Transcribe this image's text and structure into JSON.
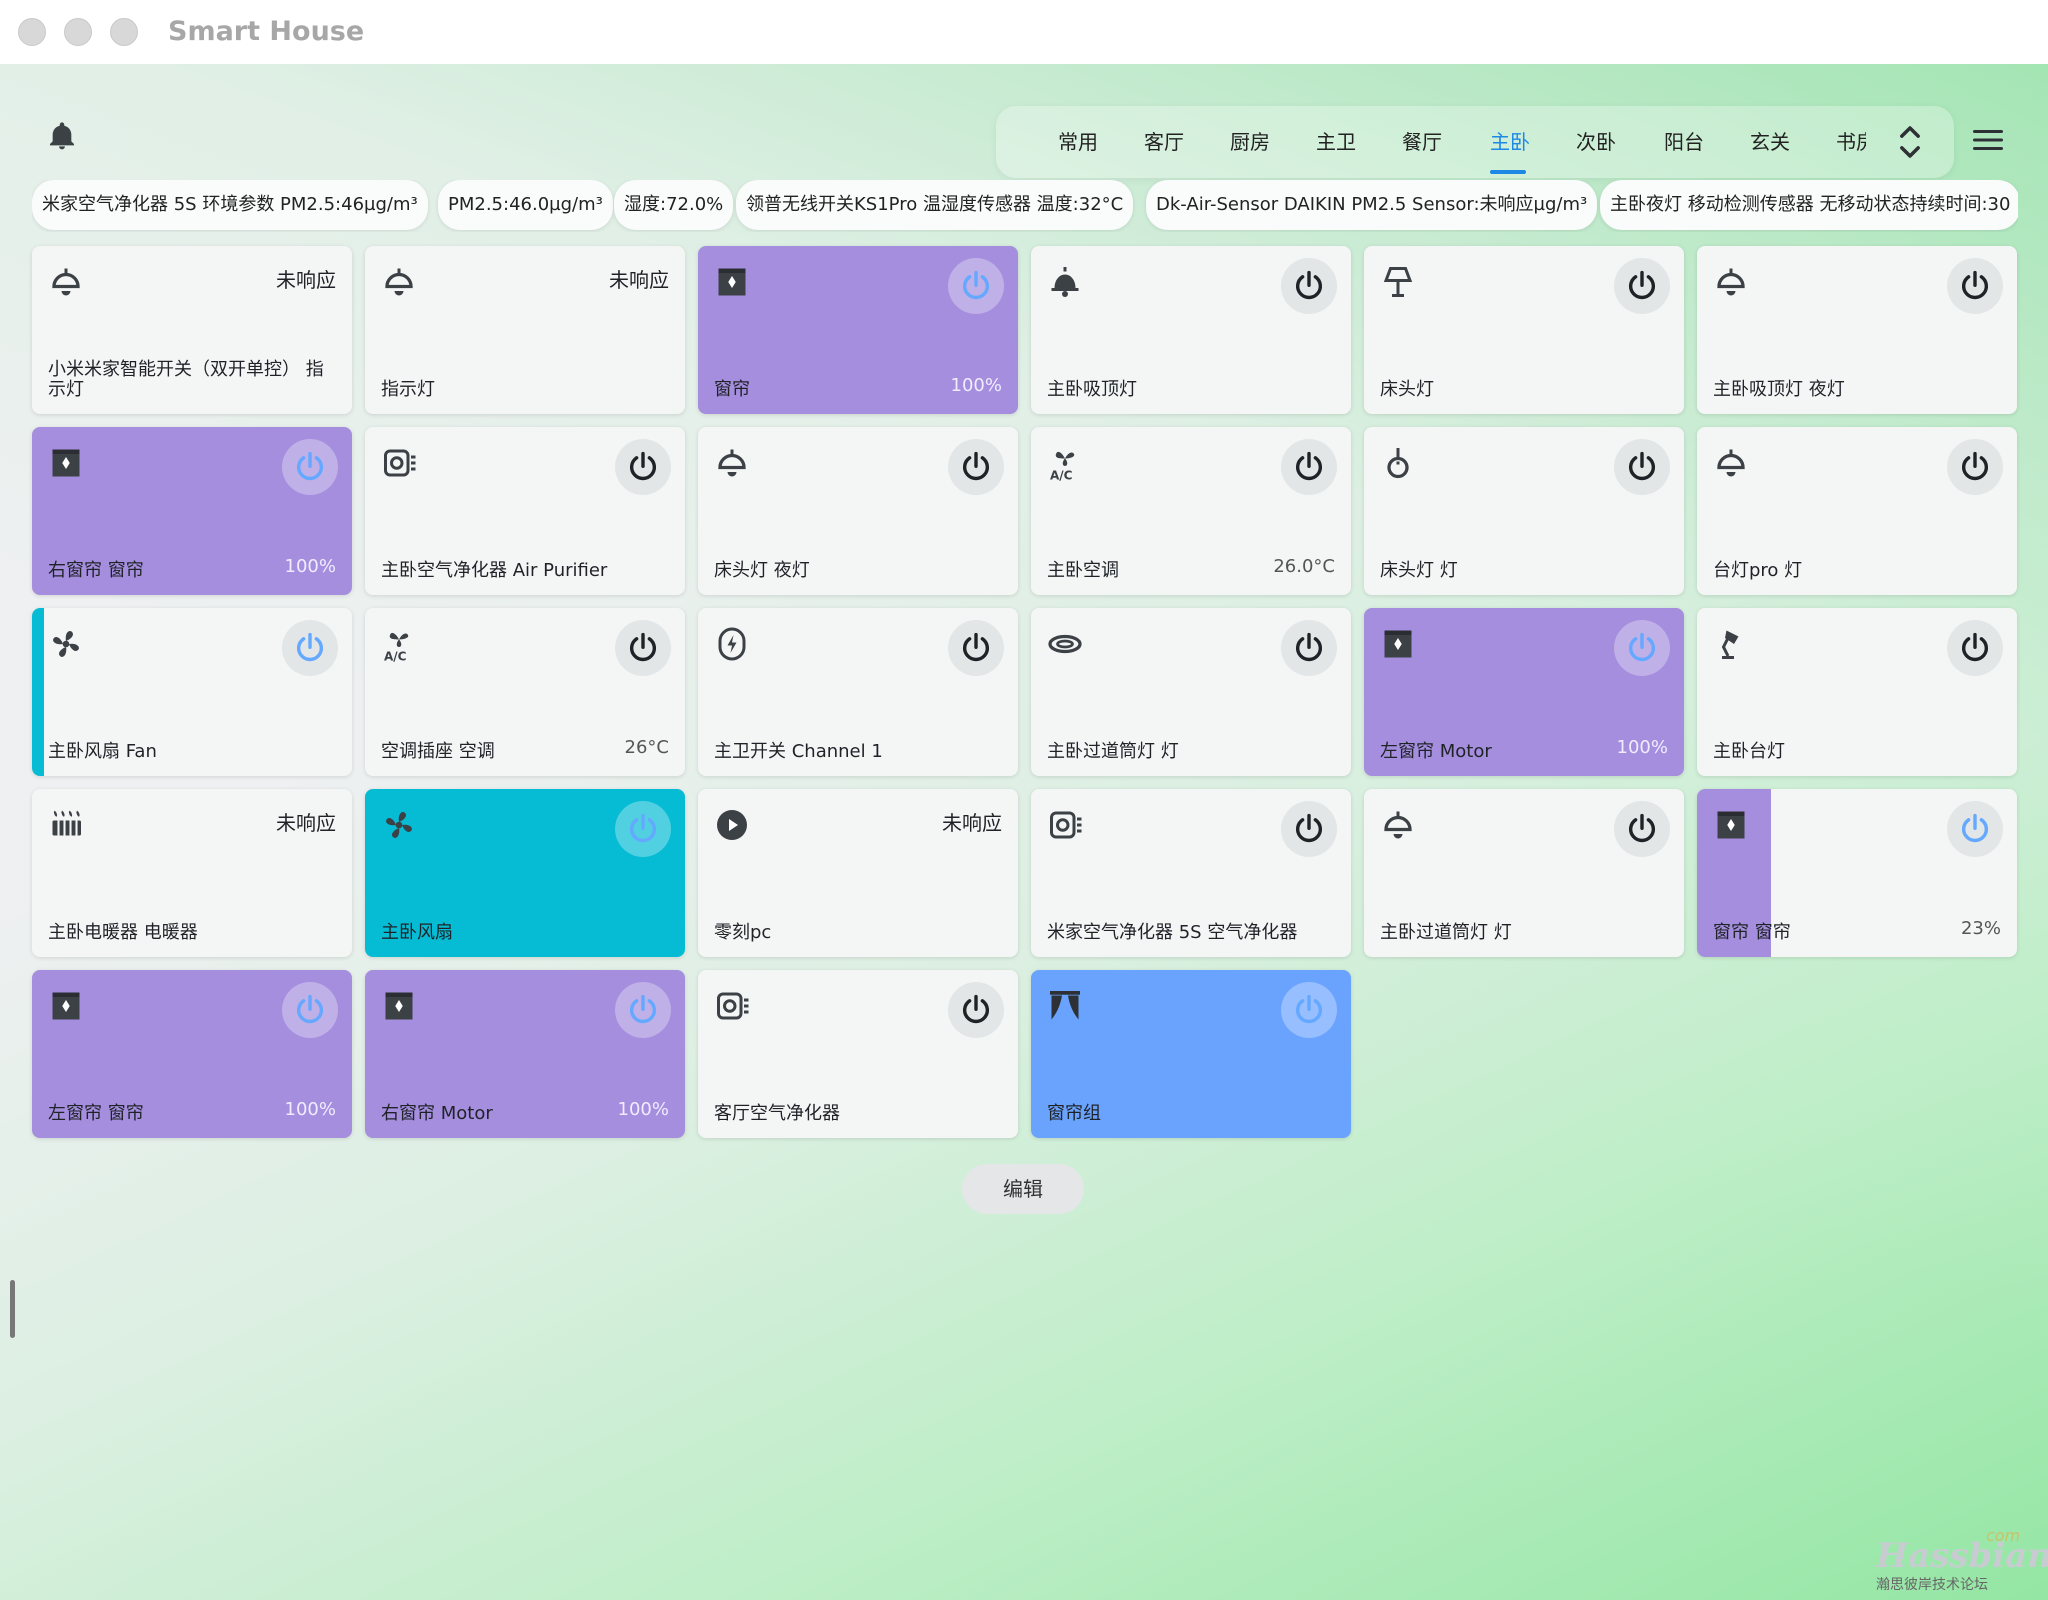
{
  "app_title": "Smart House",
  "tabs": [
    "常用",
    "客厅",
    "厨房",
    "主卫",
    "餐厅",
    "主卧",
    "次卧",
    "阳台",
    "玄关",
    "书房"
  ],
  "active_tab_index": 5,
  "chips": [
    "米家空气净化器 5S 环境参数 PM2.5:46µg/m³",
    "PM2.5:46.0µg/m³",
    "湿度:72.0%",
    "领普无线开关KS1Pro 温湿度传感器 温度:32°C",
    "Dk-Air-Sensor DAIKIN PM2.5 Sensor:未响应µg/m³",
    "主卧夜灯 移动检测传感器 无移动状态持续时间:30"
  ],
  "cards": [
    {
      "name": "小米米家智能开关（双开单控） 指示灯",
      "icon": "ceiling-light-icon",
      "status": "未响应",
      "value": "",
      "theme": "light"
    },
    {
      "name": "指示灯",
      "icon": "ceiling-light-icon",
      "status": "未响应",
      "value": "",
      "theme": "light"
    },
    {
      "name": "窗帘",
      "icon": "window-shutter-icon",
      "status": "",
      "value": "100%",
      "theme": "purple"
    },
    {
      "name": "主卧吸顶灯",
      "icon": "bell-light-icon",
      "status": "",
      "value": "",
      "theme": "light"
    },
    {
      "name": "床头灯",
      "icon": "floor-lamp-icon",
      "status": "",
      "value": "",
      "theme": "light"
    },
    {
      "name": "主卧吸顶灯 夜灯",
      "icon": "ceiling-light-icon",
      "status": "",
      "value": "",
      "theme": "light"
    },
    {
      "name": "右窗帘  窗帘",
      "icon": "window-shutter-icon",
      "status": "",
      "value": "100%",
      "theme": "purple"
    },
    {
      "name": "主卧空气净化器 Air Purifier",
      "icon": "air-purifier-icon",
      "status": "",
      "value": "",
      "theme": "light"
    },
    {
      "name": "床头灯 夜灯",
      "icon": "ceiling-light-icon",
      "status": "",
      "value": "",
      "theme": "light"
    },
    {
      "name": "主卧空调",
      "icon": "air-conditioner-icon",
      "status": "",
      "value": "26.0°C",
      "theme": "light"
    },
    {
      "name": "床头灯  灯",
      "icon": "pendant-light-icon",
      "status": "",
      "value": "",
      "theme": "light"
    },
    {
      "name": "台灯pro  灯",
      "icon": "ceiling-light-icon",
      "status": "",
      "value": "",
      "theme": "light"
    },
    {
      "name": "主卧风扇 Fan",
      "icon": "fan-icon",
      "status": "",
      "value": "",
      "theme": "accent"
    },
    {
      "name": "空调插座  空调",
      "icon": "air-conditioner-icon",
      "status": "",
      "value": "26°C",
      "theme": "light"
    },
    {
      "name": "主卫开关 Channel 1",
      "icon": "light-switch-icon",
      "status": "",
      "value": "",
      "theme": "light"
    },
    {
      "name": "主卧过道筒灯 灯",
      "icon": "downlight-icon",
      "status": "",
      "value": "",
      "theme": "light"
    },
    {
      "name": "左窗帘 Motor",
      "icon": "window-shutter-icon",
      "status": "",
      "value": "100%",
      "theme": "purple"
    },
    {
      "name": "主卧台灯",
      "icon": "desk-lamp-icon",
      "status": "",
      "value": "",
      "theme": "light"
    },
    {
      "name": "主卧电暖器  电暖器",
      "icon": "radiator-icon",
      "status": "未响应",
      "value": "",
      "theme": "light"
    },
    {
      "name": "主卧风扇",
      "icon": "fan-icon",
      "status": "",
      "value": "",
      "theme": "teal"
    },
    {
      "name": "零刻pc",
      "icon": "play-circle-icon",
      "status": "未响应",
      "value": "",
      "theme": "light"
    },
    {
      "name": "米家空气净化器 5S  空气净化器",
      "icon": "air-purifier-icon",
      "status": "",
      "value": "",
      "theme": "light"
    },
    {
      "name": "主卧过道筒灯  灯",
      "icon": "ceiling-light-icon",
      "status": "",
      "value": "",
      "theme": "light"
    },
    {
      "name": "窗帘  窗帘",
      "icon": "window-shutter-icon",
      "status": "",
      "value": "23%",
      "theme": "partial",
      "fill": 0.23
    },
    {
      "name": "左窗帘  窗帘",
      "icon": "window-shutter-icon",
      "status": "",
      "value": "100%",
      "theme": "purple"
    },
    {
      "name": "右窗帘 Motor",
      "icon": "window-shutter-icon",
      "status": "",
      "value": "100%",
      "theme": "purple"
    },
    {
      "name": "客厅空气净化器",
      "icon": "air-purifier-icon",
      "status": "",
      "value": "",
      "theme": "light"
    },
    {
      "name": "窗帘组",
      "icon": "curtains-icon",
      "status": "",
      "value": "",
      "theme": "blue"
    }
  ],
  "edit_label": "编辑",
  "watermark": {
    "brand": "Hassbian",
    "suffix": "com",
    "subtitle": "瀚思彼岸技术论坛"
  },
  "colors": {
    "active_tab": "#1e88e5",
    "purple": "#a58ede",
    "teal": "#06bcd4",
    "blue": "#6aa3fe",
    "power_on": "#64a8ff"
  }
}
